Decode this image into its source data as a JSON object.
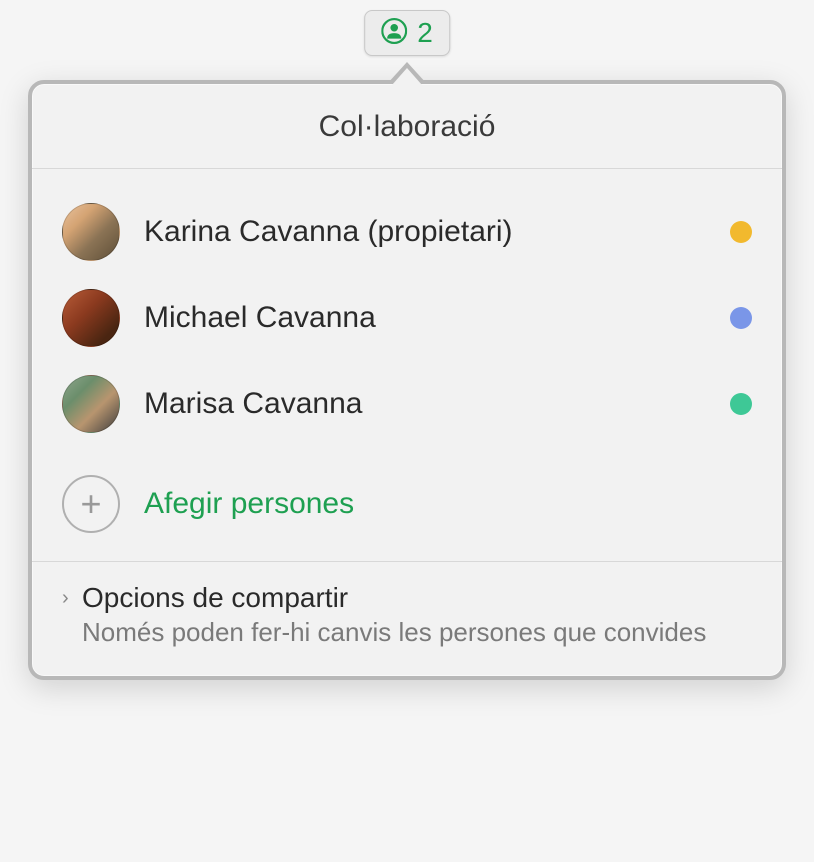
{
  "toolbar": {
    "count": "2"
  },
  "popover": {
    "title": "Col·laboració"
  },
  "participants": [
    {
      "name": "Karina Cavanna (propietari)",
      "status_color": "#f2b92e",
      "avatar_class": "avatar-1"
    },
    {
      "name": "Michael Cavanna",
      "status_color": "#7a96e8",
      "avatar_class": "avatar-2"
    },
    {
      "name": "Marisa Cavanna",
      "status_color": "#3ec896",
      "avatar_class": "avatar-3"
    }
  ],
  "add_people": {
    "label": "Afegir persones"
  },
  "share_options": {
    "title": "Opcions de compartir",
    "subtitle": "Només poden fer-hi canvis les persones que convides"
  }
}
